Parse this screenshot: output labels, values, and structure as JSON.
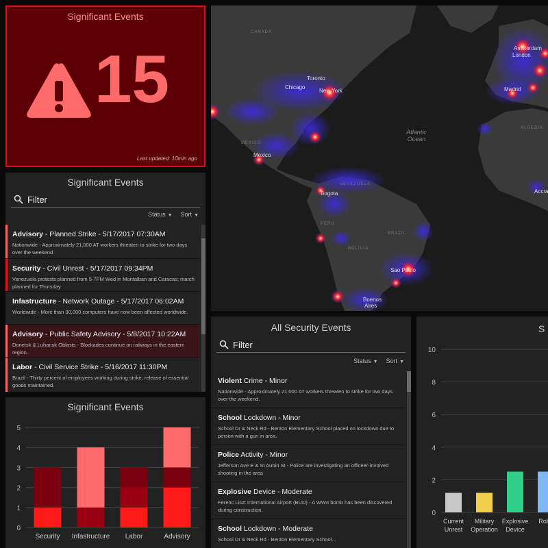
{
  "indicator": {
    "title": "Significant Events",
    "value": "15",
    "updated": "Last updated: 10min ago",
    "icon": "warning-triangle-icon",
    "colors": {
      "bg": "#5c0006",
      "border": "#d4131e",
      "fg": "#ff6b6b"
    }
  },
  "sig_list": {
    "title": "Significant Events",
    "filter": "Filter",
    "status_label": "Status",
    "sort_label": "Sort",
    "items": [
      {
        "category": "Advisory",
        "title": " - Planned Strike - 5/17/2017 07:30AM",
        "desc": "Nationwide - Approximately 21,000 AT workers threaten to strike for two days over the weekend.",
        "accent": "#ff6b6b",
        "selected": false
      },
      {
        "category": "Security",
        "title": " - Civil Unrest - 5/17/2017 09:34PM",
        "desc": "Venezuela protests planned from 5-7PM Wed in Montalban and Caracas; march planned for Thursday",
        "accent": "#e3101e",
        "selected": false
      },
      {
        "category": "Infastructure",
        "title": " - Network Outage - 5/17/2017 06:02AM",
        "desc": "Worldwide - More than 30,000 computers have now been affected worldwide.",
        "accent": "",
        "selected": false
      },
      {
        "category": "Advisory",
        "title": " - Public Safety Advisory - 5/8/2017 10:22AM",
        "desc": "Donetsk & Luhansk Oblasts - Blockades continue on railways in the eastern region.",
        "accent": "#ff6b6b",
        "selected": true
      },
      {
        "category": "Labor",
        "title": " - Civil Service Strike - 5/16/2017 11:30PM",
        "desc": "Brazil - Thirty percent of employees working during strike; release of essential goods maintained.",
        "accent": "#ff6b6b",
        "selected": false
      }
    ]
  },
  "all_list": {
    "title": "All Security Events",
    "filter": "Filter",
    "status_label": "Status",
    "sort_label": "Sort",
    "items": [
      {
        "category": "Violent",
        "title": " Crime - Minor",
        "desc": "Nationwide - Approximately 21,000 AT workers threaten to strike for two days over the weekend."
      },
      {
        "category": "School",
        "title": " Lockdown - Minor",
        "desc": "School Dr & Neck Rd - Benton Elementary School placed on lockdown due to person with a gun in area."
      },
      {
        "category": "Police",
        "title": " Activity - Minor",
        "desc": "Jefferson Ave E & St Aubin St - Police are investigating an officeer-involved shooting in the area"
      },
      {
        "category": "Explosive",
        "title": " Device - Moderate",
        "desc": "Ferenc Liszt International Airport (BUD) - A WWII bomb has been discovered during construction."
      },
      {
        "category": "School",
        "title": " Lockdown - Moderate",
        "desc": "School Dr & Neck Rd - Benton Elementary School..."
      }
    ]
  },
  "map": {
    "labels": {
      "canada": "CANADA",
      "chicago": "Chicago",
      "toronto": "Toronto",
      "new_york": "New York",
      "mexico": "MEXICO",
      "mexico_city": "Mexico",
      "atlantic": "Atlantic",
      "ocean": "Ocean",
      "amsterdam": "Amsterdam",
      "london": "London",
      "madrid": "Madrid",
      "algeria": "ALGERIA",
      "venezuela": "VENEZUELA",
      "bogota": "Bogota",
      "peru": "PERU",
      "brazil": "BRAZIL",
      "bolivia": "BOLIVIA",
      "sao_paulo": "Sao Paulo",
      "buenos": "Buenos",
      "aires": "Aires",
      "accra": "Accra"
    },
    "colors": {
      "land": "#3a3a3a",
      "water": "#1b1b1b",
      "heat_low": "#3b2bd8",
      "heat_high": "#ff3030"
    }
  },
  "chart_data": [
    {
      "type": "bar",
      "title": "Significant Events",
      "categories": [
        "Security",
        "Infastructure",
        "Labor",
        "Advisory"
      ],
      "ylim": [
        0,
        5
      ],
      "yticks": [
        "0",
        "1",
        "2",
        "3",
        "4",
        "5"
      ],
      "series": [
        {
          "values": [
            1,
            0,
            1,
            2
          ],
          "color": "#ff1a1a"
        },
        {
          "values": [
            0,
            1,
            1,
            0
          ],
          "color": "#990012"
        },
        {
          "values": [
            2,
            0,
            1,
            1
          ],
          "color": "#7a0010"
        },
        {
          "values": [
            0,
            3,
            0,
            2
          ],
          "color": "#ff6b6b"
        }
      ],
      "grid": true,
      "legend": "none"
    },
    {
      "type": "bar",
      "categories": [
        "Current Unrest",
        "Military Operation",
        "Explosive Device",
        "Robb"
      ],
      "ylim": [
        0,
        10
      ],
      "yticks": [
        "0",
        "2",
        "4",
        "6",
        "8",
        "10"
      ],
      "values": [
        1.2,
        1.2,
        2.5,
        2.5
      ],
      "colors": [
        "#c8c8c8",
        "#f2cf4a",
        "#2fd08a",
        "#7fb6f4"
      ],
      "grid": true
    }
  ]
}
